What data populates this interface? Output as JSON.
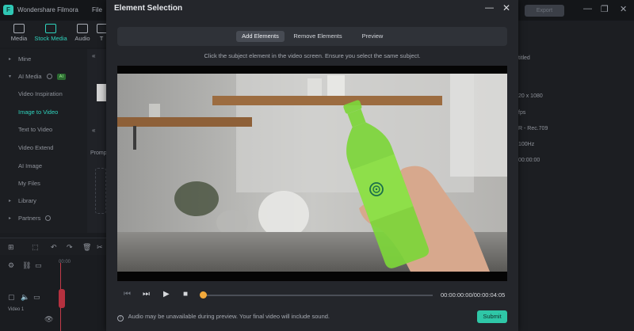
{
  "app": {
    "title": "Wondershare Filmora",
    "menu_file": "File",
    "logo_glyph": "F",
    "export_label": "Export",
    "window_min": "—",
    "window_restore": "❐",
    "window_close": "✕"
  },
  "media_tabs": [
    {
      "label": "Media",
      "icon": "media-icon"
    },
    {
      "label": "Stock Media",
      "icon": "stock-media-icon",
      "active": true
    },
    {
      "label": "Audio",
      "icon": "audio-icon"
    },
    {
      "label": "T",
      "icon": "titles-icon"
    }
  ],
  "sidebar": {
    "items": [
      {
        "label": "Mine",
        "caret": "▸"
      },
      {
        "label": "AI Media",
        "caret": "▾",
        "badge": "AI"
      },
      {
        "label": "Video Inspiration"
      },
      {
        "label": "Image to Video",
        "active": true
      },
      {
        "label": "Text to Video"
      },
      {
        "label": "Video Extend"
      },
      {
        "label": "AI Image"
      },
      {
        "label": "My Files"
      },
      {
        "label": "Library",
        "caret": "▸"
      },
      {
        "label": "Partners",
        "caret": "▸"
      }
    ]
  },
  "browser": {
    "chevron": "«",
    "chevron_lower": "«",
    "prompt_label": "Promp"
  },
  "timeline": {
    "ruler_start": "00:00",
    "track_label": "Video 1"
  },
  "right_panel": {
    "project_name": "titled",
    "resolution": "20 x 1080",
    "frame_rate": "fps",
    "color_space": "R - Rec.709",
    "sample_rate": "100Hz",
    "duration": "00:00:00"
  },
  "modal": {
    "title": "Element Selection",
    "minimize_glyph": "—",
    "close_glyph": "✕",
    "tabs": [
      {
        "label": "Add Elements",
        "active": true
      },
      {
        "label": "Remove Elements",
        "active": false
      },
      {
        "label": "Preview",
        "active": false
      }
    ],
    "instruction": "Click the subject element in the video screen. Ensure you select the same subject.",
    "controls": {
      "prev_frame_glyph": "⏮",
      "next_frame_glyph": "⏭",
      "play_glyph": "▶",
      "stop_glyph": "■",
      "timecode": "00:00:00:00/00:00:04:05",
      "progress_fraction": 0
    },
    "footer_note": "Audio may be unavailable during preview. Your final video will include sound.",
    "info_glyph": "!",
    "submit_label": "Submit"
  },
  "colors": {
    "accent": "#2fc7a7",
    "selection_mask": "#7dd63a",
    "knob": "#f2a93b"
  }
}
